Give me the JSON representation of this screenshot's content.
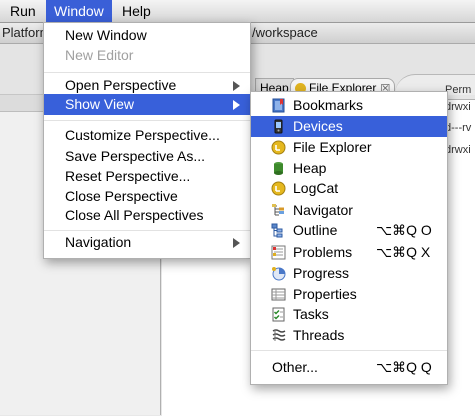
{
  "menubar": {
    "items": [
      {
        "label": "Run"
      },
      {
        "label": "Window"
      },
      {
        "label": "Help"
      }
    ]
  },
  "background": {
    "title_left": "Platform",
    "title_right": "/workspace",
    "tabs": [
      {
        "label": "Heap"
      },
      {
        "label": "File Explorer",
        "close": "☒"
      }
    ],
    "column_header": "Perm",
    "perm_values": [
      "drwxi",
      "d---rv",
      "drwxi"
    ]
  },
  "window_menu": {
    "items": [
      {
        "label": "New Window"
      },
      {
        "label": "New Editor",
        "disabled": true
      },
      {
        "label": "Open Perspective"
      },
      {
        "label": "Show View"
      },
      {
        "label": "Customize Perspective..."
      },
      {
        "label": "Save Perspective As..."
      },
      {
        "label": "Reset Perspective..."
      },
      {
        "label": "Close Perspective"
      },
      {
        "label": "Close All Perspectives"
      },
      {
        "label": "Navigation"
      }
    ]
  },
  "show_view_menu": {
    "items": [
      {
        "label": "Bookmarks",
        "icon": "bookmarks-icon"
      },
      {
        "label": "Devices",
        "icon": "devices-icon"
      },
      {
        "label": "File Explorer",
        "icon": "file-explorer-icon"
      },
      {
        "label": "Heap",
        "icon": "heap-icon"
      },
      {
        "label": "LogCat",
        "icon": "logcat-icon"
      },
      {
        "label": "Navigator",
        "icon": "navigator-icon"
      },
      {
        "label": "Outline",
        "icon": "outline-icon",
        "shortcut": "⌥⌘Q O"
      },
      {
        "label": "Problems",
        "icon": "problems-icon",
        "shortcut": "⌥⌘Q X"
      },
      {
        "label": "Progress",
        "icon": "progress-icon"
      },
      {
        "label": "Properties",
        "icon": "properties-icon"
      },
      {
        "label": "Tasks",
        "icon": "tasks-icon"
      },
      {
        "label": "Threads",
        "icon": "threads-icon"
      },
      {
        "label": "Other...",
        "shortcut": "⌥⌘Q Q"
      }
    ]
  },
  "colors": {
    "highlight": "#3860da",
    "menubar_active": "#3a5fd7"
  }
}
